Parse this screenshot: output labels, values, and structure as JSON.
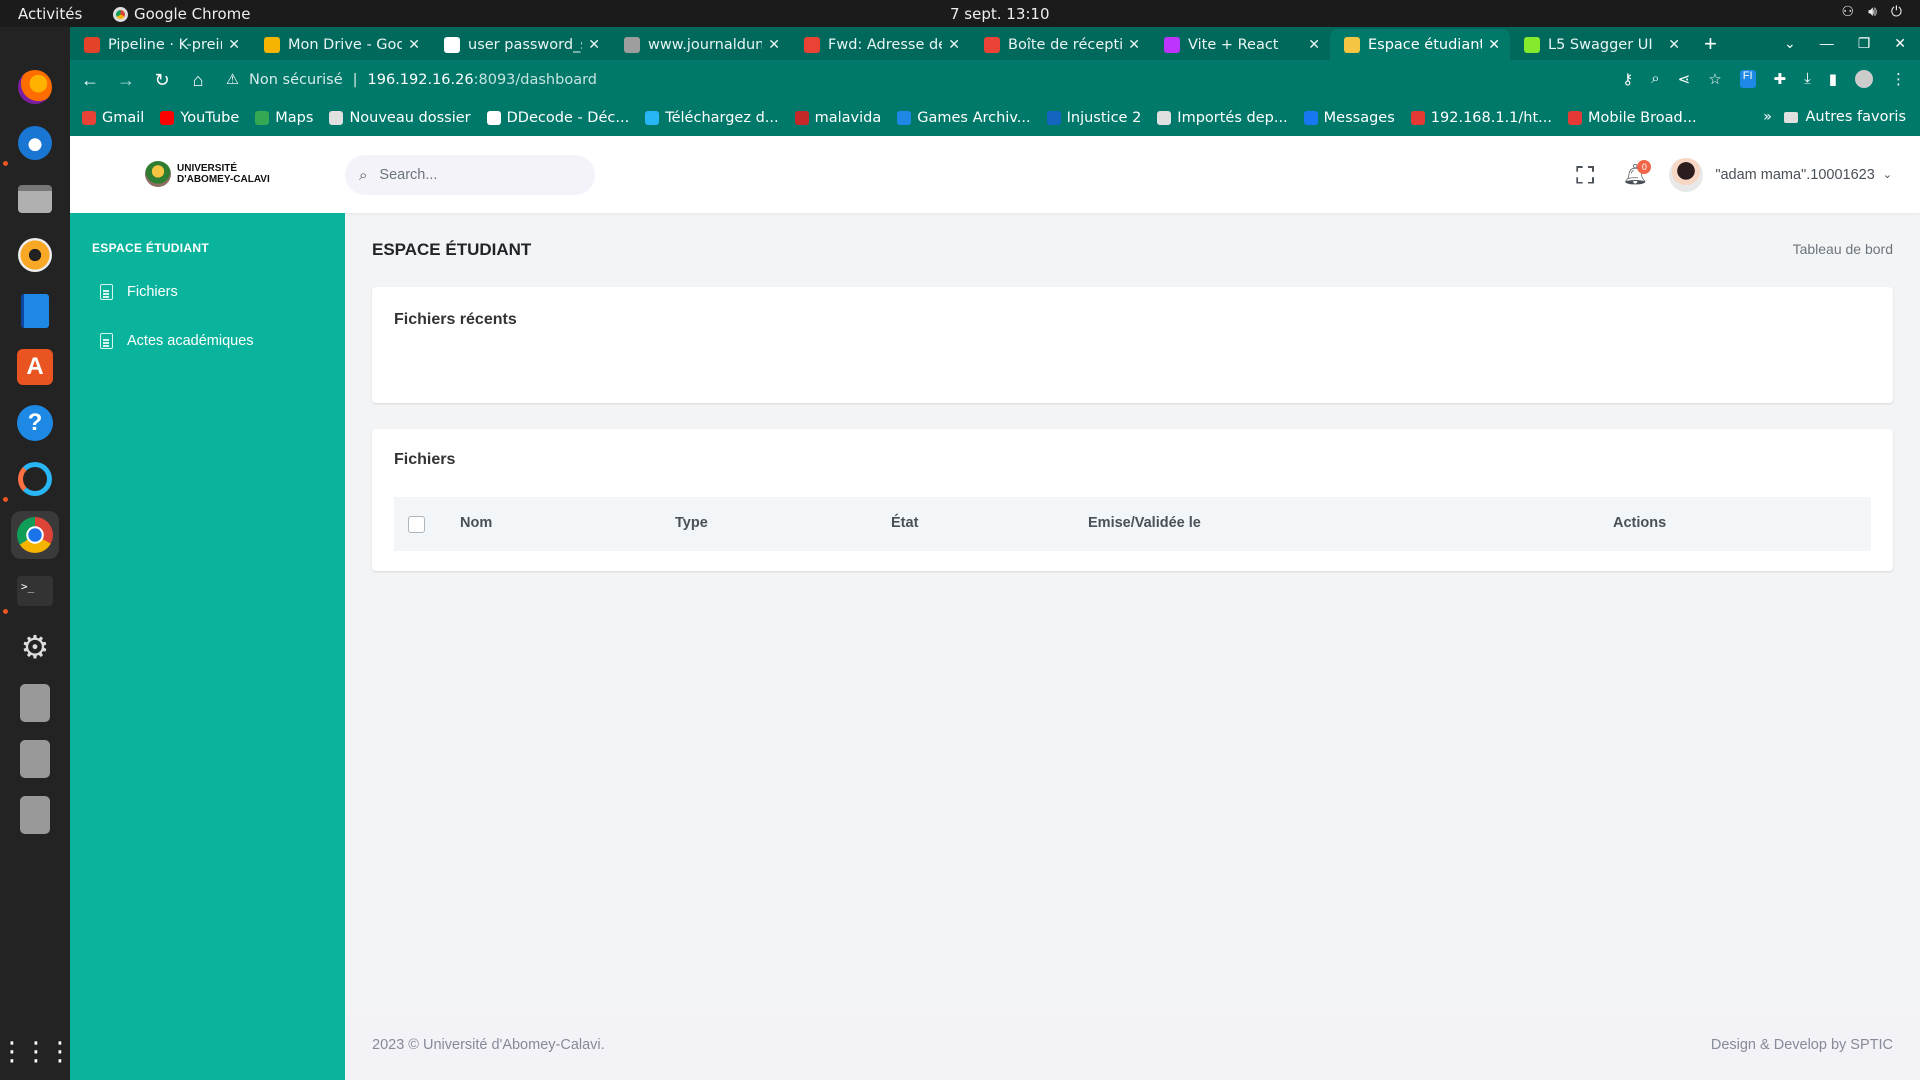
{
  "system": {
    "activities": "Activités",
    "app_name": "Google Chrome",
    "clock": "7 sept.  13:10"
  },
  "tabs": [
    {
      "label": "Pipeline · K-prein",
      "icon": "gitlab-icon",
      "color": "#e24329"
    },
    {
      "label": "Mon Drive - Goog",
      "icon": "drive-icon",
      "color": "#f4b400"
    },
    {
      "label": "user password_s",
      "icon": "doc-icon",
      "color": "#ffffff"
    },
    {
      "label": "www.journaldun",
      "icon": "globe-icon",
      "color": "#9e9e9e"
    },
    {
      "label": "Fwd: Adresse de",
      "icon": "gmail-icon",
      "color": "#ea4335"
    },
    {
      "label": "Boîte de réceptio",
      "icon": "gmail-icon",
      "color": "#ea4335"
    },
    {
      "label": "Vite + React",
      "icon": "vite-icon",
      "color": "#bd34fe"
    },
    {
      "label": "Espace étudiant",
      "icon": "uac-icon",
      "color": "#f4c542",
      "active": true
    },
    {
      "label": "L5 Swagger UI",
      "icon": "swagger-icon",
      "color": "#85ea2d"
    }
  ],
  "address": {
    "security": "Non sécurisé",
    "host": "196.192.16.26",
    "path": ":8093/dashboard"
  },
  "bookmarks": [
    {
      "label": "Gmail",
      "icon": "gmail-icon",
      "color": "#ea4335"
    },
    {
      "label": "YouTube",
      "icon": "youtube-icon",
      "color": "#ff0000"
    },
    {
      "label": "Maps",
      "icon": "maps-icon",
      "color": "#34a853"
    },
    {
      "label": "Nouveau dossier",
      "icon": "folder-icon",
      "color": "#e0e0e0"
    },
    {
      "label": "DDecode - Déc...",
      "icon": "globe-icon",
      "color": "#ffffff"
    },
    {
      "label": "Téléchargez d...",
      "icon": "download-site-icon",
      "color": "#29b6f6"
    },
    {
      "label": "malavida",
      "icon": "malavida-icon",
      "color": "#c62828"
    },
    {
      "label": "Games Archiv...",
      "icon": "globe-icon",
      "color": "#1e88e5"
    },
    {
      "label": "Injustice 2",
      "icon": "injustice-icon",
      "color": "#1565c0"
    },
    {
      "label": "Importés dep...",
      "icon": "folder-icon",
      "color": "#e0e0e0"
    },
    {
      "label": "Messages",
      "icon": "facebook-icon",
      "color": "#1877f2"
    },
    {
      "label": "192.168.1.1/ht...",
      "icon": "huawei-icon",
      "color": "#e53935"
    },
    {
      "label": "Mobile Broad...",
      "icon": "huawei-icon",
      "color": "#e53935"
    }
  ],
  "bookmarks_more": "»",
  "bookmarks_other": "Autres favoris",
  "header": {
    "logo_line1": "UNIVERSITÉ",
    "logo_line2": "D'ABOMEY-CALAVI",
    "search_placeholder": "Search...",
    "notifications": "0",
    "user": "\"adam mama\".10001623"
  },
  "sidebar": {
    "title": "ESPACE ÉTUDIANT",
    "items": [
      {
        "label": "Fichiers",
        "icon": "file-icon"
      },
      {
        "label": "Actes académiques",
        "icon": "file-icon"
      }
    ]
  },
  "main": {
    "title": "ESPACE ÉTUDIANT",
    "breadcrumb": "Tableau de bord",
    "recent_title": "Fichiers récents",
    "files_title": "Fichiers",
    "columns": [
      "Nom",
      "Type",
      "État",
      "Emise/Validée le",
      "Actions"
    ]
  },
  "footer": {
    "left": "2023 © Université d'Abomey-Calavi.",
    "right": "Design & Develop by SPTIC"
  },
  "colors": {
    "browser_frame": "#00796b",
    "sidebar": "#0ab39c",
    "badge": "#f06548"
  }
}
